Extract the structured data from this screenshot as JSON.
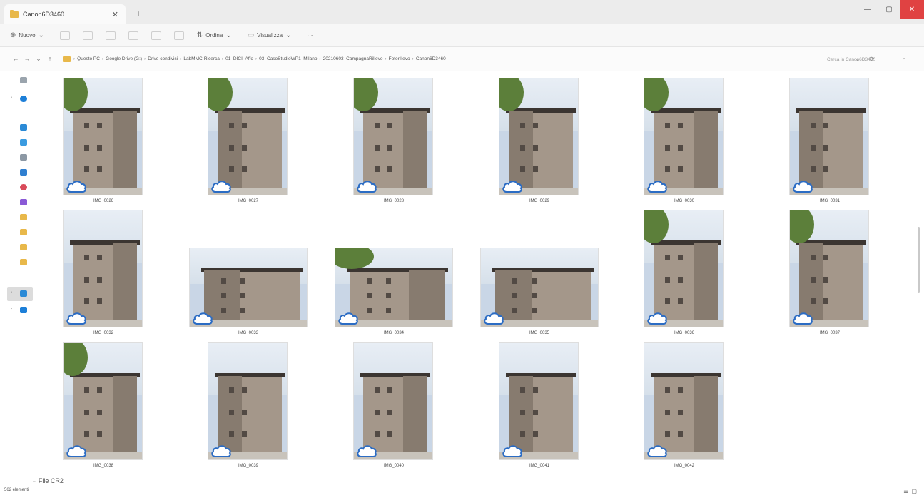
{
  "window": {
    "tab_title": "Canon6D3460",
    "tab_close": "✕",
    "new_tab": "+",
    "minimize": "—",
    "maximize": "▢",
    "close": "✕"
  },
  "commandbar": {
    "new_label": "Nuovo",
    "sort_label": "Ordina",
    "view_label": "Visualizza",
    "more_label": "···"
  },
  "address": {
    "back": "←",
    "forward": "→",
    "up_history": "⌄",
    "up": "↑",
    "crumbs": [
      "Questo PC",
      "Google Drive (G:)",
      "Drive condivisi",
      "LabMMC-Ricerca",
      "01_DICI_Affo",
      "03_CasoStudioWP1_Milano",
      "20210603_CampagnaRilievo",
      "Fotorilievo",
      "Canon6D3460"
    ],
    "refresh": "⟳",
    "search_placeholder": "Cerca in Canon6D3460",
    "search_icon": "⌕",
    "recent_icon": "⌄"
  },
  "files": [
    {
      "name": "IMG_0026"
    },
    {
      "name": "IMG_0027"
    },
    {
      "name": "IMG_0028"
    },
    {
      "name": "IMG_0029"
    },
    {
      "name": "IMG_0030"
    },
    {
      "name": "IMG_0031"
    },
    {
      "name": "IMG_0032"
    },
    {
      "name": "IMG_0033"
    },
    {
      "name": "IMG_0034"
    },
    {
      "name": "IMG_0035"
    },
    {
      "name": "IMG_0036"
    },
    {
      "name": "IMG_0037"
    },
    {
      "name": "IMG_0038"
    },
    {
      "name": "IMG_0039"
    },
    {
      "name": "IMG_0040"
    },
    {
      "name": "IMG_0041"
    },
    {
      "name": "IMG_0042"
    }
  ],
  "status": {
    "group_label": "File CR2",
    "group_chevron": "⌄",
    "item_count": "562 elementi",
    "view_details": "☰",
    "view_large": "▢"
  },
  "colors": {
    "accent": "#e04242",
    "folder": "#e8b84a",
    "cloud": "#2b6cc4"
  }
}
